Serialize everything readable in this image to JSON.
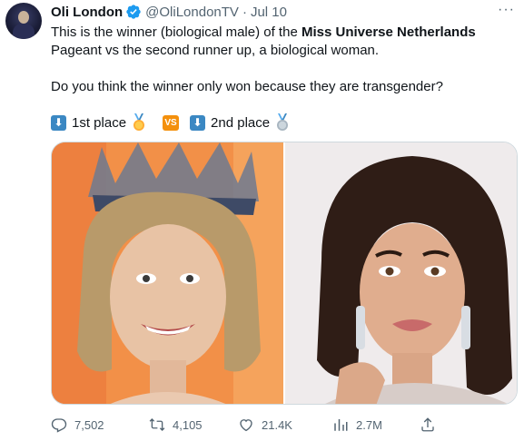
{
  "author": {
    "name": "Oli London",
    "handle": "@OliLondonTV",
    "separator": "·",
    "date": "Jul 10"
  },
  "tweet": {
    "text_part1": "This is the winner (biological male) of the ",
    "text_bold": "Miss Universe Netherlands",
    "text_part2": " Pageant vs the second runner up, a biological woman.",
    "question": "Do you think the winner only won because they are transgender?",
    "first_label": "1st place",
    "vs_label": "VS",
    "second_label": "2nd place"
  },
  "icons": {
    "verified": "verified-badge-icon",
    "arrow": "down-arrow-emoji",
    "first_medal": "first-place-medal-emoji",
    "second_medal": "second-place-medal-emoji",
    "more": "more-options-icon"
  },
  "more_label": "···",
  "actions": {
    "replies": "7,502",
    "retweets": "4,105",
    "likes": "21.4K",
    "views": "2.7M"
  },
  "colors": {
    "text": "#0f1419",
    "secondary": "#536471",
    "verified_blue": "#1d9bf0",
    "keycap_blue": "#3b88c3",
    "vs_orange": "#f4900c"
  }
}
